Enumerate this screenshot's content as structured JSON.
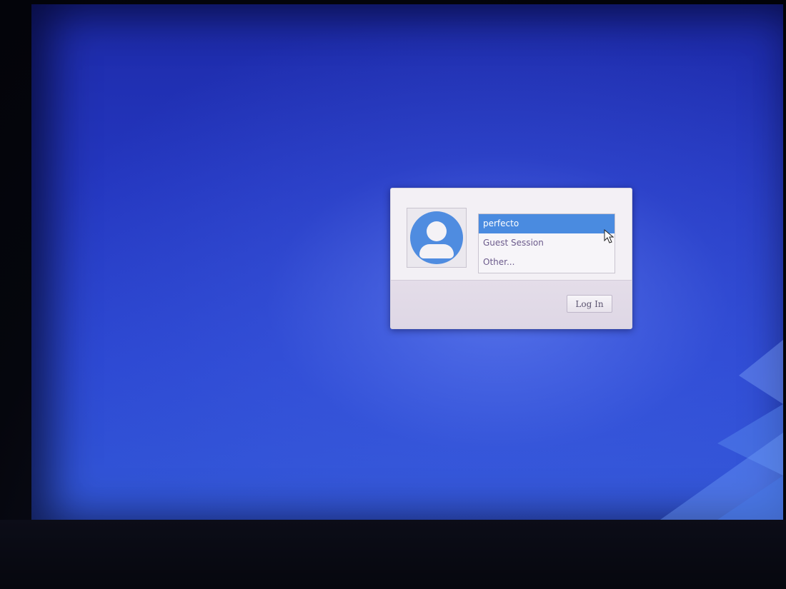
{
  "login_dialog": {
    "users": [
      {
        "label": "perfecto",
        "selected": true
      },
      {
        "label": "Guest Session",
        "selected": false
      },
      {
        "label": "Other...",
        "selected": false
      }
    ],
    "login_button_label": "Log In"
  },
  "icons": {
    "avatar": "user-avatar-icon",
    "cursor": "mouse-pointer-icon"
  },
  "colors": {
    "accent": "#4a8be0",
    "desktop": "#2c48d2"
  }
}
